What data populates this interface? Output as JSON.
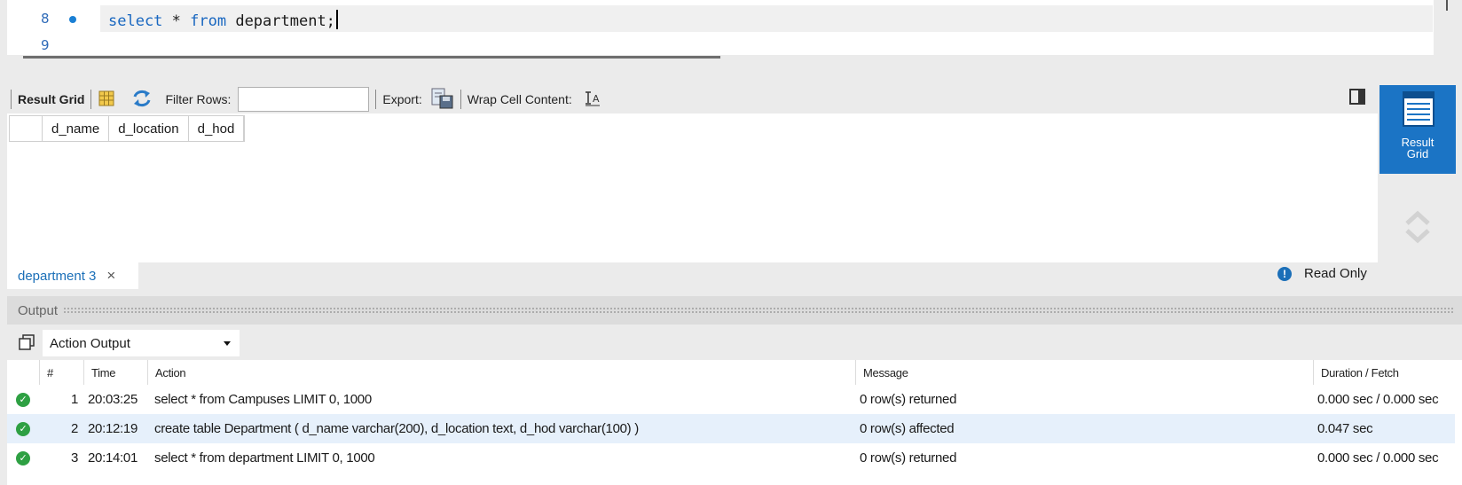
{
  "editor": {
    "lines": [
      {
        "num": "8",
        "code_kw1": "select",
        "code_mid": " * ",
        "code_kw2": "from",
        "code_rest": " department;"
      },
      {
        "num": "9"
      }
    ]
  },
  "result_toolbar": {
    "result_grid_label": "Result Grid",
    "filter_rows_label": "Filter Rows:",
    "filter_value": "",
    "export_label": "Export:",
    "wrap_label": "Wrap Cell Content:"
  },
  "result_grid": {
    "columns": [
      "d_name",
      "d_location",
      "d_hod"
    ],
    "rows": []
  },
  "sidebar": {
    "tab_line1": "Result",
    "tab_line2": "Grid"
  },
  "tabs": {
    "active_tab": "department 3",
    "read_only": "Read Only"
  },
  "output": {
    "title": "Output",
    "selector": "Action Output",
    "columns": [
      "#",
      "Time",
      "Action",
      "Message",
      "Duration / Fetch"
    ],
    "rows": [
      {
        "num": "1",
        "time": "20:03:25",
        "action": "select * from Campuses LIMIT 0, 1000",
        "message": "0 row(s) returned",
        "duration": "0.000 sec / 0.000 sec"
      },
      {
        "num": "2",
        "time": "20:12:19",
        "action": "create table Department ( d_name varchar(200), d_location text, d_hod varchar(100) )",
        "message": "0 row(s) affected",
        "duration": "0.047 sec"
      },
      {
        "num": "3",
        "time": "20:14:01",
        "action": "select * from department LIMIT 0, 1000",
        "message": "0 row(s) returned",
        "duration": "0.000 sec / 0.000 sec"
      }
    ]
  },
  "colors": {
    "accent": "#1b74c5",
    "success": "#2ea043",
    "keyword": "#1967c0"
  }
}
